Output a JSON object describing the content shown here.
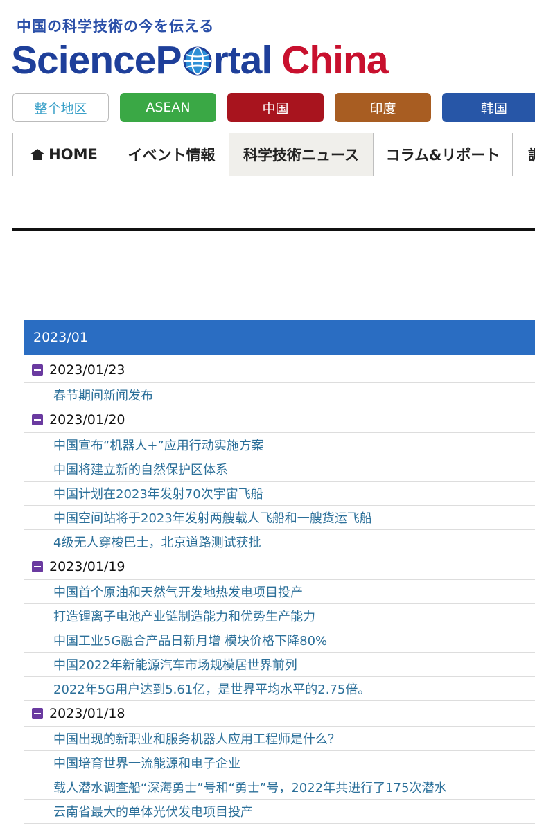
{
  "header": {
    "tagline": "中国の科学技術の今を伝える",
    "logo_part1": "ScienceP",
    "logo_part2": "rtal",
    "logo_part3": "China",
    "colors": {
      "blue": "#1e3f9a",
      "red": "#c8102e"
    }
  },
  "regions": [
    {
      "label": "整个地区",
      "color": "#ffffff"
    },
    {
      "label": "ASEAN",
      "color": "#3aa845"
    },
    {
      "label": "中国",
      "color": "#a8141e"
    },
    {
      "label": "印度",
      "color": "#a85d22"
    },
    {
      "label": "韩国",
      "color": "#2756a7"
    }
  ],
  "nav": {
    "home": "HOME",
    "event": "イベント情報",
    "news": "科学技術ニュース",
    "column": "コラム&リポート",
    "more": "調"
  },
  "archive": {
    "month": "2023/01",
    "groups": [
      {
        "date": "2023/01/23",
        "articles": [
          "春节期间新闻发布"
        ]
      },
      {
        "date": "2023/01/20",
        "articles": [
          "中国宣布“机器人+”应用行动实施方案",
          "中国将建立新的自然保护区体系",
          "中国计划在2023年发射70次宇宙飞船",
          "中国空间站将于2023年发射两艘载人飞船和一艘货运飞船",
          "4级无人穿梭巴士，北京道路测试获批"
        ]
      },
      {
        "date": "2023/01/19",
        "articles": [
          "中国首个原油和天然气开发地热发电项目投产",
          "打造锂离子电池产业链制造能力和优势生产能力",
          "中国工业5G融合产品日新月增 模块价格下降80%",
          "中国2022年新能源汽车市场规模居世界前列",
          "2022年5G用户达到5.61亿，是世界平均水平的2.75倍。"
        ]
      },
      {
        "date": "2023/01/18",
        "articles": [
          "中国出现的新职业和服务机器人应用工程师是什么？",
          "中国培育世界一流能源和电子企业",
          "载人潜水调查船“深海勇士”号和“勇士”号，2022年共进行了175次潜水",
          "云南省最大的单体光伏发电项目投产"
        ]
      }
    ]
  }
}
